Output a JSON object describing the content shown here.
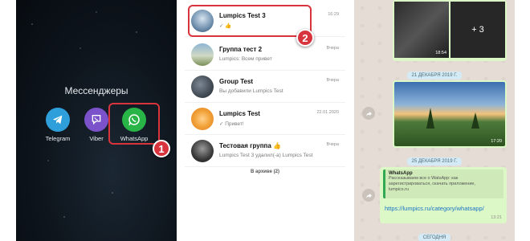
{
  "home": {
    "folder_title": "Мессенджеры",
    "apps": [
      {
        "label": "Telegram",
        "icon": "telegram-icon"
      },
      {
        "label": "Viber",
        "icon": "viber-icon"
      },
      {
        "label": "WhatsApp",
        "icon": "whatsapp-icon"
      }
    ],
    "step_badge": "1"
  },
  "chats": {
    "items": [
      {
        "name": "Lumpics Test 3",
        "preview": "✓ 👍",
        "time": "16:29"
      },
      {
        "name": "Группа тест 2",
        "preview": "Lumpics: Всем привет",
        "time": "Вчера"
      },
      {
        "name": "Group Test",
        "preview": "Вы добавили Lumpics Test",
        "time": "Вчера"
      },
      {
        "name": "Lumpics Test",
        "preview": "✓ Привет!",
        "time": "22.01.2020"
      },
      {
        "name": "Тестовая группа 👍",
        "preview": "Lumpics Test 3 удалил(-а) Lumpics Test",
        "time": "Вчера"
      }
    ],
    "archive": "В архиве (2)",
    "step_badge": "2"
  },
  "conversation": {
    "gallery": {
      "more": "+ 3",
      "time": "18:54"
    },
    "date1": "21 ДЕКАБРЯ 2019 Г.",
    "photo_time": "17:20",
    "date2": "25 ДЕКАБРЯ 2019 Г.",
    "link": {
      "title": "WhatsApp",
      "desc": "Рассказываем все о WatsApp: как зарегистрироваться, скачать приложение,",
      "site": "lumpics.ru",
      "url": "https://lumpics.ru/category/whatsapp/",
      "time": "13:21"
    },
    "date3": "СЕГОДНЯ"
  },
  "colors": {
    "highlight": "#d8343d",
    "whatsapp_green": "#28b446",
    "bubble": "#dcf8c6",
    "chat_bg": "#e5ddd5"
  }
}
